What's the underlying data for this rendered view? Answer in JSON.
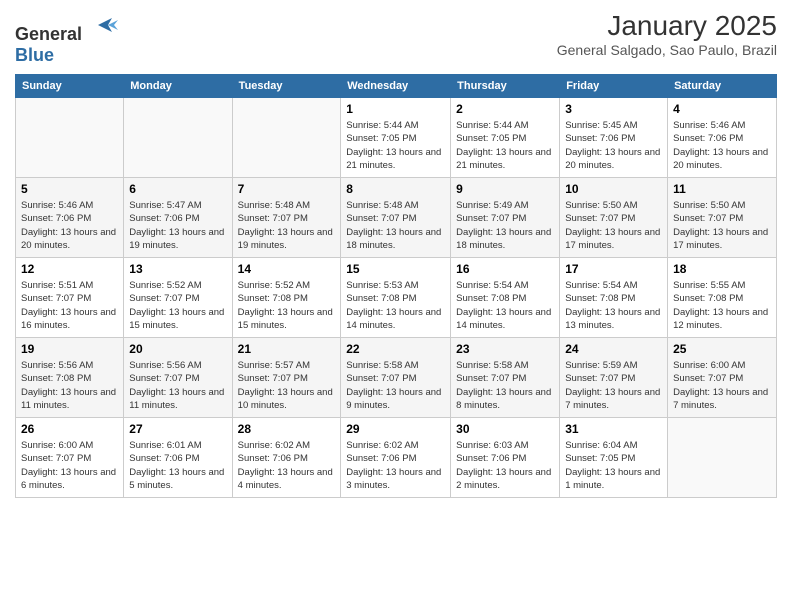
{
  "header": {
    "logo": {
      "general": "General",
      "blue": "Blue"
    },
    "title": "January 2025",
    "subtitle": "General Salgado, Sao Paulo, Brazil"
  },
  "days_of_week": [
    "Sunday",
    "Monday",
    "Tuesday",
    "Wednesday",
    "Thursday",
    "Friday",
    "Saturday"
  ],
  "weeks": [
    [
      {
        "day": "",
        "info": ""
      },
      {
        "day": "",
        "info": ""
      },
      {
        "day": "",
        "info": ""
      },
      {
        "day": "1",
        "info": "Sunrise: 5:44 AM\nSunset: 7:05 PM\nDaylight: 13 hours and 21 minutes."
      },
      {
        "day": "2",
        "info": "Sunrise: 5:44 AM\nSunset: 7:05 PM\nDaylight: 13 hours and 21 minutes."
      },
      {
        "day": "3",
        "info": "Sunrise: 5:45 AM\nSunset: 7:06 PM\nDaylight: 13 hours and 20 minutes."
      },
      {
        "day": "4",
        "info": "Sunrise: 5:46 AM\nSunset: 7:06 PM\nDaylight: 13 hours and 20 minutes."
      }
    ],
    [
      {
        "day": "5",
        "info": "Sunrise: 5:46 AM\nSunset: 7:06 PM\nDaylight: 13 hours and 20 minutes."
      },
      {
        "day": "6",
        "info": "Sunrise: 5:47 AM\nSunset: 7:06 PM\nDaylight: 13 hours and 19 minutes."
      },
      {
        "day": "7",
        "info": "Sunrise: 5:48 AM\nSunset: 7:07 PM\nDaylight: 13 hours and 19 minutes."
      },
      {
        "day": "8",
        "info": "Sunrise: 5:48 AM\nSunset: 7:07 PM\nDaylight: 13 hours and 18 minutes."
      },
      {
        "day": "9",
        "info": "Sunrise: 5:49 AM\nSunset: 7:07 PM\nDaylight: 13 hours and 18 minutes."
      },
      {
        "day": "10",
        "info": "Sunrise: 5:50 AM\nSunset: 7:07 PM\nDaylight: 13 hours and 17 minutes."
      },
      {
        "day": "11",
        "info": "Sunrise: 5:50 AM\nSunset: 7:07 PM\nDaylight: 13 hours and 17 minutes."
      }
    ],
    [
      {
        "day": "12",
        "info": "Sunrise: 5:51 AM\nSunset: 7:07 PM\nDaylight: 13 hours and 16 minutes."
      },
      {
        "day": "13",
        "info": "Sunrise: 5:52 AM\nSunset: 7:07 PM\nDaylight: 13 hours and 15 minutes."
      },
      {
        "day": "14",
        "info": "Sunrise: 5:52 AM\nSunset: 7:08 PM\nDaylight: 13 hours and 15 minutes."
      },
      {
        "day": "15",
        "info": "Sunrise: 5:53 AM\nSunset: 7:08 PM\nDaylight: 13 hours and 14 minutes."
      },
      {
        "day": "16",
        "info": "Sunrise: 5:54 AM\nSunset: 7:08 PM\nDaylight: 13 hours and 14 minutes."
      },
      {
        "day": "17",
        "info": "Sunrise: 5:54 AM\nSunset: 7:08 PM\nDaylight: 13 hours and 13 minutes."
      },
      {
        "day": "18",
        "info": "Sunrise: 5:55 AM\nSunset: 7:08 PM\nDaylight: 13 hours and 12 minutes."
      }
    ],
    [
      {
        "day": "19",
        "info": "Sunrise: 5:56 AM\nSunset: 7:08 PM\nDaylight: 13 hours and 11 minutes."
      },
      {
        "day": "20",
        "info": "Sunrise: 5:56 AM\nSunset: 7:07 PM\nDaylight: 13 hours and 11 minutes."
      },
      {
        "day": "21",
        "info": "Sunrise: 5:57 AM\nSunset: 7:07 PM\nDaylight: 13 hours and 10 minutes."
      },
      {
        "day": "22",
        "info": "Sunrise: 5:58 AM\nSunset: 7:07 PM\nDaylight: 13 hours and 9 minutes."
      },
      {
        "day": "23",
        "info": "Sunrise: 5:58 AM\nSunset: 7:07 PM\nDaylight: 13 hours and 8 minutes."
      },
      {
        "day": "24",
        "info": "Sunrise: 5:59 AM\nSunset: 7:07 PM\nDaylight: 13 hours and 7 minutes."
      },
      {
        "day": "25",
        "info": "Sunrise: 6:00 AM\nSunset: 7:07 PM\nDaylight: 13 hours and 7 minutes."
      }
    ],
    [
      {
        "day": "26",
        "info": "Sunrise: 6:00 AM\nSunset: 7:07 PM\nDaylight: 13 hours and 6 minutes."
      },
      {
        "day": "27",
        "info": "Sunrise: 6:01 AM\nSunset: 7:06 PM\nDaylight: 13 hours and 5 minutes."
      },
      {
        "day": "28",
        "info": "Sunrise: 6:02 AM\nSunset: 7:06 PM\nDaylight: 13 hours and 4 minutes."
      },
      {
        "day": "29",
        "info": "Sunrise: 6:02 AM\nSunset: 7:06 PM\nDaylight: 13 hours and 3 minutes."
      },
      {
        "day": "30",
        "info": "Sunrise: 6:03 AM\nSunset: 7:06 PM\nDaylight: 13 hours and 2 minutes."
      },
      {
        "day": "31",
        "info": "Sunrise: 6:04 AM\nSunset: 7:05 PM\nDaylight: 13 hours and 1 minute."
      },
      {
        "day": "",
        "info": ""
      }
    ]
  ]
}
